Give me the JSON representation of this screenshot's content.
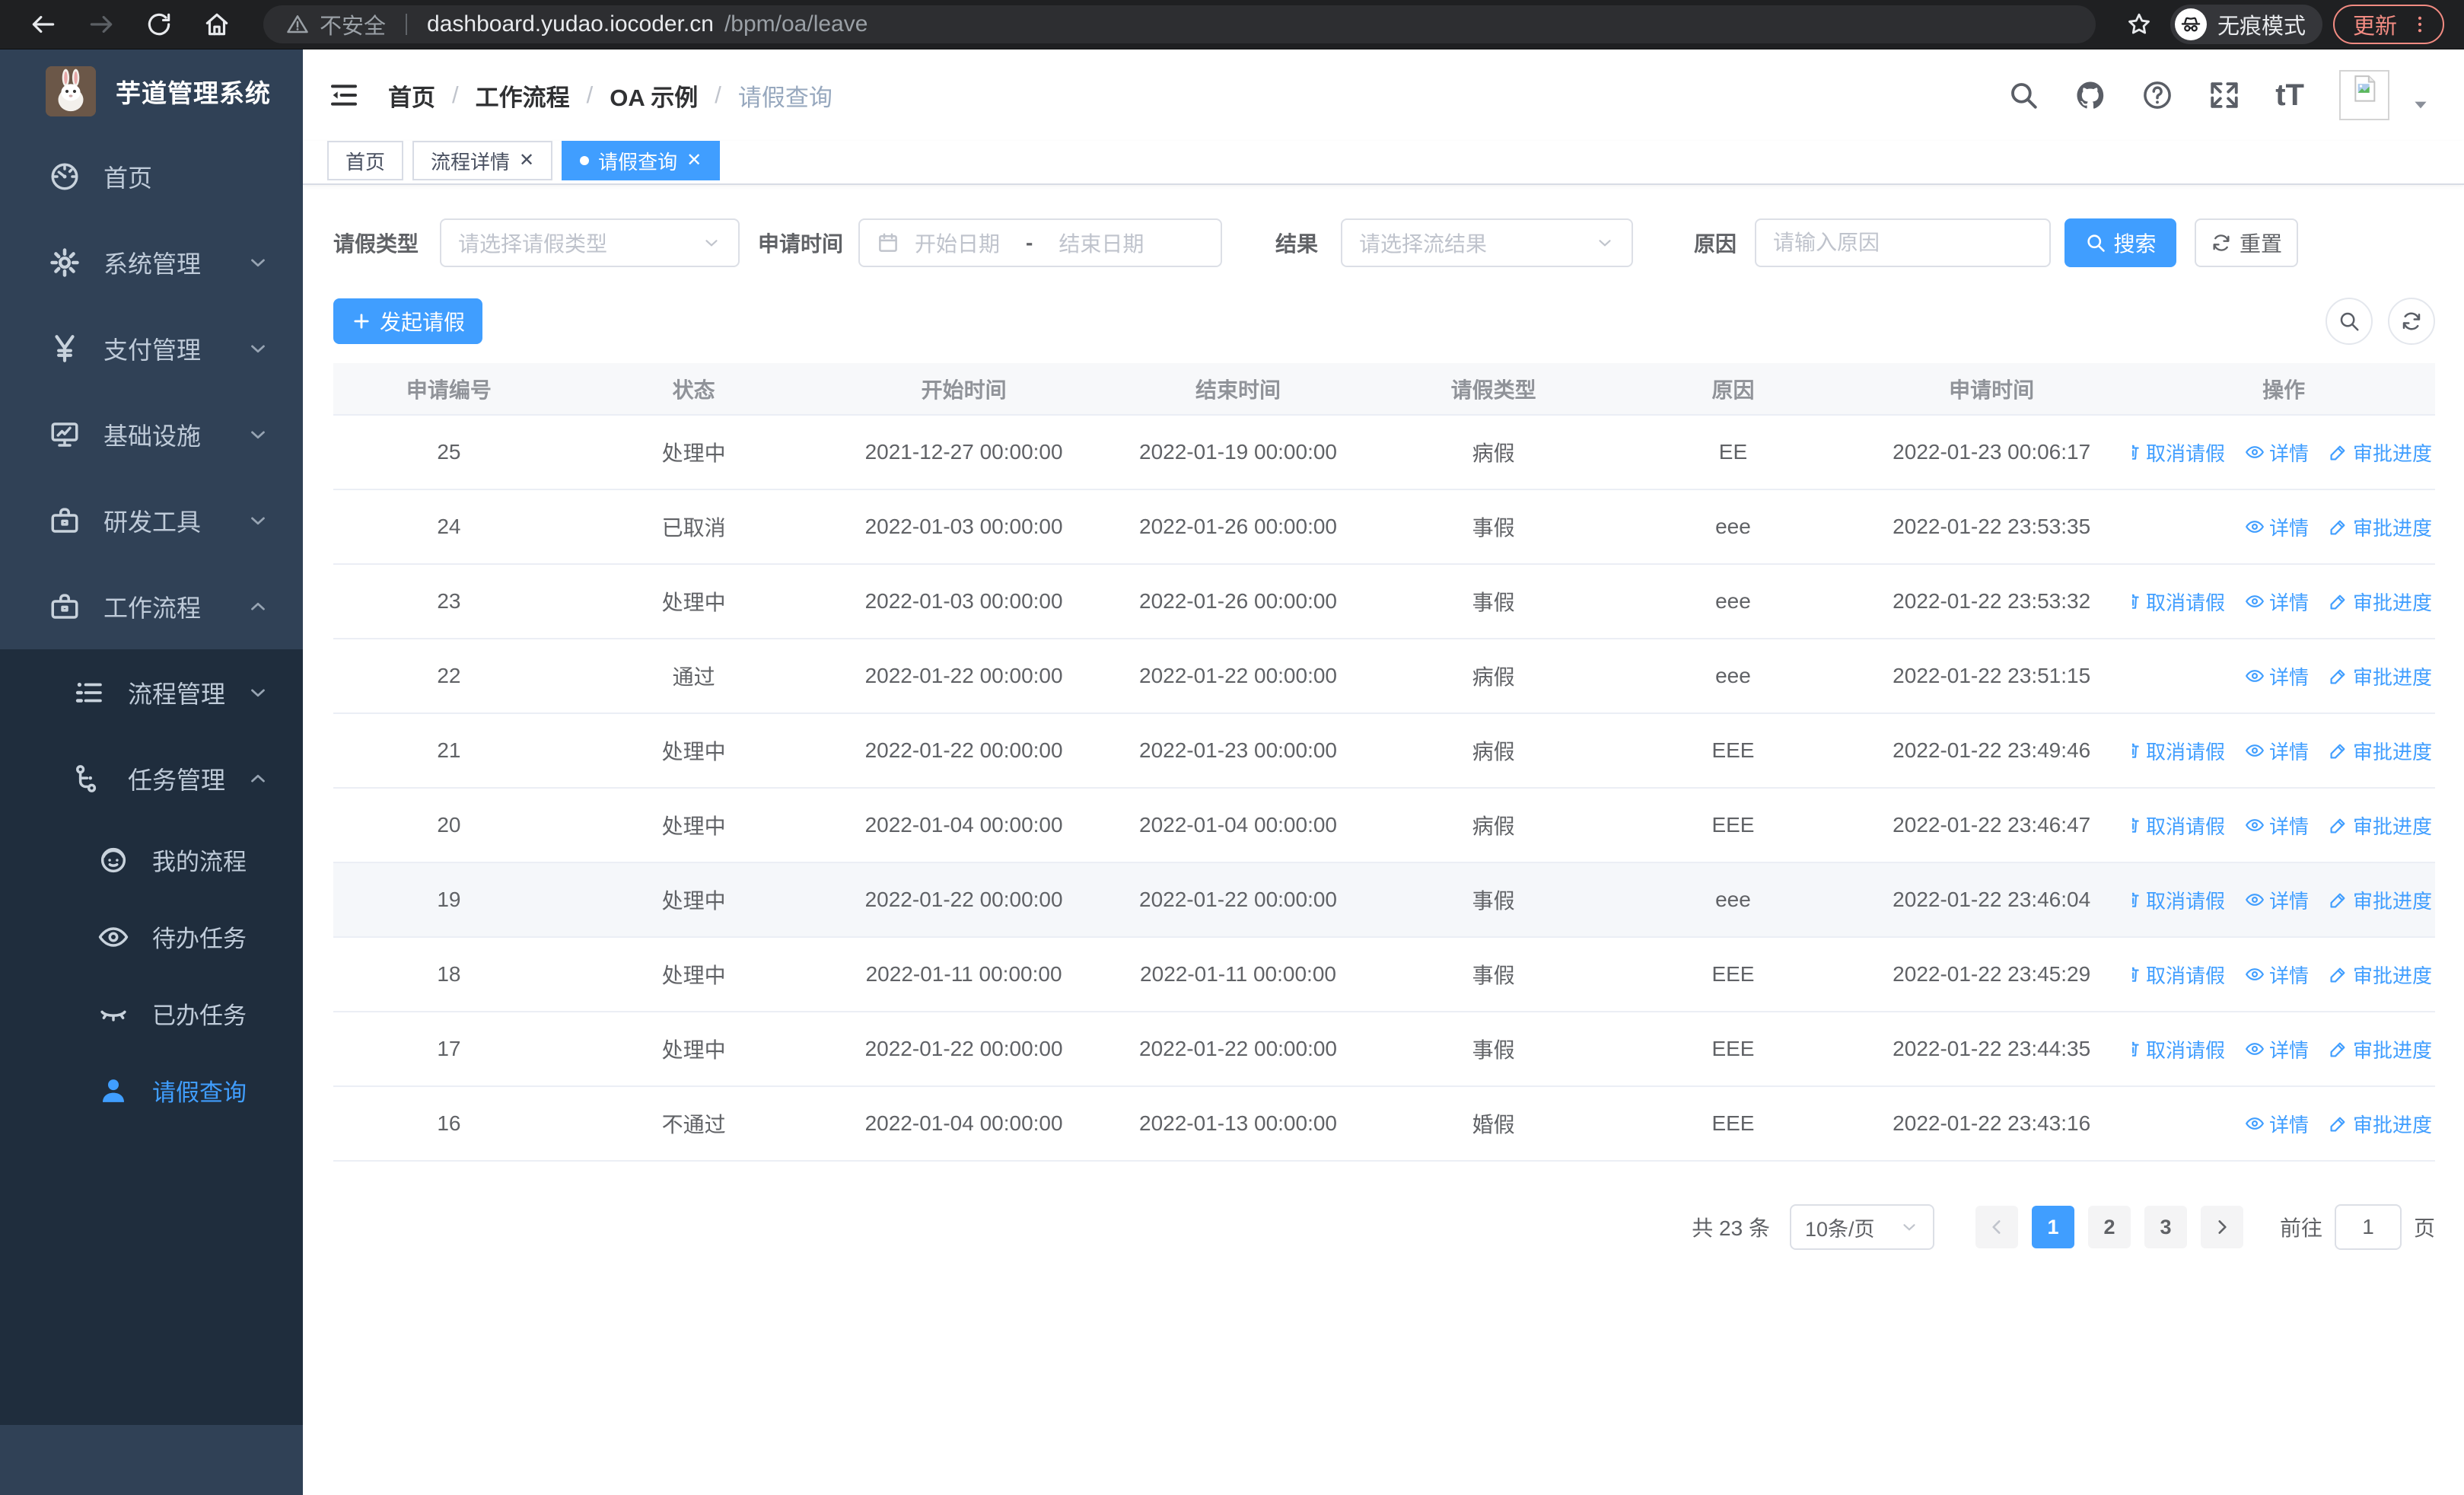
{
  "browser": {
    "security": "不安全",
    "host": "dashboard.yudao.iocoder.cn",
    "path": "/bpm/oa/leave",
    "incognito": "无痕模式",
    "update": "更新"
  },
  "sidebar": {
    "title": "芋道管理系统",
    "menu": [
      {
        "label": "首页",
        "icon": "dashboard",
        "chevron": null
      },
      {
        "label": "系统管理",
        "icon": "gear",
        "chevron": "down"
      },
      {
        "label": "支付管理",
        "icon": "yen",
        "chevron": "down"
      },
      {
        "label": "基础设施",
        "icon": "monitor",
        "chevron": "down"
      },
      {
        "label": "研发工具",
        "icon": "toolbox",
        "chevron": "down"
      },
      {
        "label": "工作流程",
        "icon": "briefcase",
        "chevron": "up"
      }
    ],
    "submenu": [
      {
        "label": "流程管理",
        "icon": "list",
        "chevron": "down",
        "level": 1,
        "active": false
      },
      {
        "label": "任务管理",
        "icon": "tree",
        "chevron": "up",
        "level": 1,
        "active": false
      },
      {
        "label": "我的流程",
        "icon": "face",
        "chevron": null,
        "level": 2,
        "active": false
      },
      {
        "label": "待办任务",
        "icon": "eye",
        "chevron": null,
        "level": 2,
        "active": false
      },
      {
        "label": "已办任务",
        "icon": "eye-closed",
        "chevron": null,
        "level": 2,
        "active": false
      },
      {
        "label": "请假查询",
        "icon": "user",
        "chevron": null,
        "level": 2,
        "active": true
      }
    ]
  },
  "breadcrumb": {
    "items": [
      "首页",
      "工作流程",
      "OA 示例",
      "请假查询"
    ]
  },
  "tabs": [
    {
      "label": "首页",
      "closable": false,
      "active": false
    },
    {
      "label": "流程详情",
      "closable": true,
      "active": false
    },
    {
      "label": "请假查询",
      "closable": true,
      "active": true
    }
  ],
  "filters": {
    "leave_type_label": "请假类型",
    "leave_type_placeholder": "请选择请假类型",
    "apply_time_label": "申请时间",
    "date_start_placeholder": "开始日期",
    "date_separator": "-",
    "date_end_placeholder": "结束日期",
    "result_label": "结果",
    "result_placeholder": "请选择流结果",
    "reason_label": "原因",
    "reason_placeholder": "请输入原因",
    "search_label": "搜索",
    "reset_label": "重置"
  },
  "toolbar": {
    "create_label": "发起请假"
  },
  "table": {
    "columns": [
      "申请编号",
      "状态",
      "开始时间",
      "结束时间",
      "请假类型",
      "原因",
      "申请时间",
      "操作"
    ],
    "action_labels": {
      "cancel": "取消请假",
      "detail": "详情",
      "progress": "审批进度"
    },
    "rows": [
      {
        "id": "25",
        "status": "处理中",
        "start": "2021-12-27 00:00:00",
        "end": "2022-01-19 00:00:00",
        "type": "病假",
        "reason": "EE",
        "apply": "2022-01-23 00:06:17",
        "actions": [
          "cancel",
          "detail",
          "progress"
        ],
        "highlight": false
      },
      {
        "id": "24",
        "status": "已取消",
        "start": "2022-01-03 00:00:00",
        "end": "2022-01-26 00:00:00",
        "type": "事假",
        "reason": "eee",
        "apply": "2022-01-22 23:53:35",
        "actions": [
          "detail",
          "progress"
        ],
        "highlight": false
      },
      {
        "id": "23",
        "status": "处理中",
        "start": "2022-01-03 00:00:00",
        "end": "2022-01-26 00:00:00",
        "type": "事假",
        "reason": "eee",
        "apply": "2022-01-22 23:53:32",
        "actions": [
          "cancel",
          "detail",
          "progress"
        ],
        "highlight": false
      },
      {
        "id": "22",
        "status": "通过",
        "start": "2022-01-22 00:00:00",
        "end": "2022-01-22 00:00:00",
        "type": "病假",
        "reason": "eee",
        "apply": "2022-01-22 23:51:15",
        "actions": [
          "detail",
          "progress"
        ],
        "highlight": false
      },
      {
        "id": "21",
        "status": "处理中",
        "start": "2022-01-22 00:00:00",
        "end": "2022-01-23 00:00:00",
        "type": "病假",
        "reason": "EEE",
        "apply": "2022-01-22 23:49:46",
        "actions": [
          "cancel",
          "detail",
          "progress"
        ],
        "highlight": false
      },
      {
        "id": "20",
        "status": "处理中",
        "start": "2022-01-04 00:00:00",
        "end": "2022-01-04 00:00:00",
        "type": "病假",
        "reason": "EEE",
        "apply": "2022-01-22 23:46:47",
        "actions": [
          "cancel",
          "detail",
          "progress"
        ],
        "highlight": false
      },
      {
        "id": "19",
        "status": "处理中",
        "start": "2022-01-22 00:00:00",
        "end": "2022-01-22 00:00:00",
        "type": "事假",
        "reason": "eee",
        "apply": "2022-01-22 23:46:04",
        "actions": [
          "cancel",
          "detail",
          "progress"
        ],
        "highlight": true
      },
      {
        "id": "18",
        "status": "处理中",
        "start": "2022-01-11 00:00:00",
        "end": "2022-01-11 00:00:00",
        "type": "事假",
        "reason": "EEE",
        "apply": "2022-01-22 23:45:29",
        "actions": [
          "cancel",
          "detail",
          "progress"
        ],
        "highlight": false
      },
      {
        "id": "17",
        "status": "处理中",
        "start": "2022-01-22 00:00:00",
        "end": "2022-01-22 00:00:00",
        "type": "事假",
        "reason": "EEE",
        "apply": "2022-01-22 23:44:35",
        "actions": [
          "cancel",
          "detail",
          "progress"
        ],
        "highlight": false
      },
      {
        "id": "16",
        "status": "不通过",
        "start": "2022-01-04 00:00:00",
        "end": "2022-01-13 00:00:00",
        "type": "婚假",
        "reason": "EEE",
        "apply": "2022-01-22 23:43:16",
        "actions": [
          "detail",
          "progress"
        ],
        "highlight": false
      }
    ]
  },
  "pagination": {
    "total": "共 23 条",
    "page_size": "10条/页",
    "pages": [
      "1",
      "2",
      "3"
    ],
    "active_page": "1",
    "goto": "前往",
    "goto_value": "1",
    "unit": "页"
  }
}
